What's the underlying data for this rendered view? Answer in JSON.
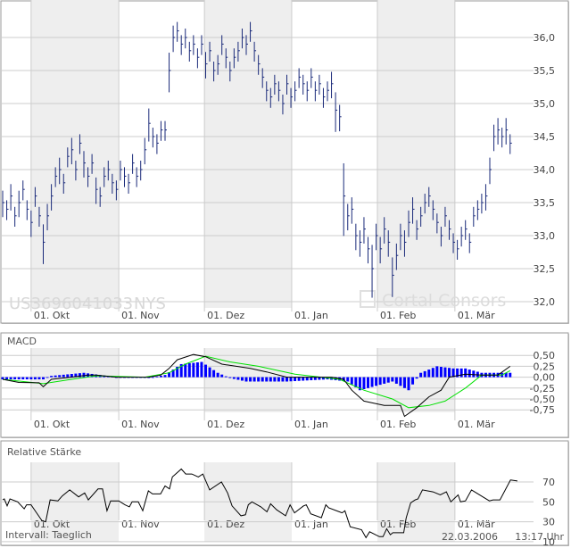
{
  "chart_data": [
    {
      "type": "ohlc",
      "title": "",
      "watermark_symbol": "US3696041033",
      "watermark_exchange": "NYS",
      "watermark_brand": "Cortal Consors",
      "yticks": [
        "36,0",
        "35,5",
        "35,0",
        "34,5",
        "34,0",
        "33,5",
        "33,0",
        "32,5",
        "32,0"
      ],
      "ytick_values": [
        36.0,
        35.5,
        35.0,
        34.5,
        34.0,
        33.5,
        33.0,
        32.5,
        32.0
      ],
      "ylim": [
        31.9,
        36.55
      ],
      "xlabels": [
        "01. Okt",
        "01. Nov",
        "01. Dez",
        "01. Jan",
        "01. Feb",
        "01. Mär"
      ],
      "month_start_bar": [
        7,
        28.6,
        49.7,
        71.2,
        92.3,
        111.4
      ],
      "bars": 126,
      "close": [
        33.5,
        33.4,
        33.6,
        33.3,
        33.5,
        33.7,
        33.4,
        33.2,
        33.6,
        33.3,
        32.9,
        33.3,
        33.6,
        33.9,
        34.0,
        33.8,
        34.2,
        34.3,
        34.0,
        34.4,
        34.1,
        33.9,
        34.1,
        33.7,
        33.6,
        33.9,
        34.0,
        33.8,
        33.7,
        34.0,
        33.9,
        33.8,
        34.1,
        33.9,
        34.0,
        34.3,
        34.7,
        34.5,
        34.4,
        34.6,
        34.6,
        35.5,
        36.0,
        36.1,
        35.9,
        36.0,
        35.8,
        35.9,
        35.7,
        35.9,
        35.6,
        35.8,
        35.5,
        35.6,
        35.9,
        35.7,
        35.5,
        35.7,
        35.8,
        36.0,
        35.9,
        36.1,
        35.8,
        35.6,
        35.4,
        35.2,
        35.1,
        35.3,
        35.2,
        35.0,
        35.3,
        35.1,
        35.2,
        35.4,
        35.3,
        35.2,
        35.4,
        35.2,
        35.3,
        35.1,
        35.2,
        35.3,
        34.9,
        34.8,
        33.6,
        33.3,
        33.4,
        33.0,
        32.9,
        33.1,
        32.8,
        32.5,
        33.0,
        32.8,
        33.1,
        32.9,
        32.4,
        32.7,
        33.0,
        32.9,
        33.2,
        33.4,
        33.1,
        33.3,
        33.5,
        33.6,
        33.4,
        33.2,
        33.0,
        33.3,
        33.1,
        32.9,
        32.8,
        33.0,
        33.1,
        32.9,
        33.3,
        33.4,
        33.5,
        33.6,
        34.0,
        34.5,
        34.6,
        34.5,
        34.6,
        34.4
      ],
      "range": [
        0.4,
        0.3,
        0.4,
        0.3,
        0.4,
        0.3,
        0.3,
        0.4,
        0.3,
        0.3,
        0.6,
        0.4,
        0.4,
        0.3,
        0.4,
        0.3,
        0.3,
        0.4,
        0.3,
        0.3,
        0.4,
        0.3,
        0.3,
        0.4,
        0.3,
        0.3,
        0.3,
        0.3,
        0.3,
        0.3,
        0.3,
        0.3,
        0.3,
        0.3,
        0.3,
        0.4,
        0.5,
        0.3,
        0.3,
        0.3,
        0.3,
        0.6,
        0.4,
        0.3,
        0.3,
        0.3,
        0.3,
        0.3,
        0.3,
        0.3,
        0.4,
        0.3,
        0.3,
        0.3,
        0.3,
        0.3,
        0.3,
        0.3,
        0.3,
        0.3,
        0.3,
        0.3,
        0.3,
        0.3,
        0.3,
        0.3,
        0.3,
        0.3,
        0.3,
        0.3,
        0.3,
        0.3,
        0.3,
        0.3,
        0.3,
        0.3,
        0.3,
        0.3,
        0.3,
        0.3,
        0.3,
        0.4,
        0.6,
        0.4,
        1.1,
        0.4,
        0.4,
        0.4,
        0.4,
        0.4,
        0.4,
        0.8,
        0.4,
        0.4,
        0.4,
        0.4,
        0.6,
        0.4,
        0.4,
        0.4,
        0.4,
        0.4,
        0.3,
        0.3,
        0.3,
        0.3,
        0.3,
        0.3,
        0.3,
        0.3,
        0.3,
        0.3,
        0.3,
        0.3,
        0.3,
        0.3,
        0.3,
        0.3,
        0.3,
        0.4,
        0.4,
        0.4,
        0.4,
        0.3,
        0.4,
        0.3
      ]
    },
    {
      "type": "line",
      "title": "MACD",
      "yticks": [
        "0,50",
        "0,25",
        "0,00",
        "-0,25",
        "-0,50",
        "-0,75"
      ],
      "ytick_values": [
        0.5,
        0.25,
        0,
        -0.25,
        -0.5,
        -0.75
      ],
      "ylim": [
        -0.95,
        0.7
      ],
      "macd": [
        [
          0,
          -0.05
        ],
        [
          4,
          -0.12
        ],
        [
          9,
          -0.13
        ],
        [
          10,
          -0.22
        ],
        [
          12,
          -0.05
        ],
        [
          17,
          0.0
        ],
        [
          21,
          0.05
        ],
        [
          23,
          0.05
        ],
        [
          28,
          0.0
        ],
        [
          36,
          0.0
        ],
        [
          39,
          0.05
        ],
        [
          41,
          0.2
        ],
        [
          43,
          0.4
        ],
        [
          47,
          0.52
        ],
        [
          50,
          0.47
        ],
        [
          54,
          0.3
        ],
        [
          61,
          0.2
        ],
        [
          65,
          0.12
        ],
        [
          70,
          0.0
        ],
        [
          81,
          0.0
        ],
        [
          84,
          -0.05
        ],
        [
          86,
          -0.3
        ],
        [
          89,
          -0.55
        ],
        [
          94,
          -0.65
        ],
        [
          98,
          -0.65
        ],
        [
          99,
          -0.9
        ],
        [
          102,
          -0.7
        ],
        [
          105,
          -0.45
        ],
        [
          108,
          -0.3
        ],
        [
          110,
          0.0
        ],
        [
          114,
          0.07
        ],
        [
          118,
          0.05
        ],
        [
          122,
          0.05
        ],
        [
          125,
          0.25
        ]
      ],
      "signal": [
        [
          0,
          -0.05
        ],
        [
          10,
          -0.15
        ],
        [
          17,
          -0.05
        ],
        [
          23,
          0.03
        ],
        [
          35,
          0.0
        ],
        [
          41,
          0.1
        ],
        [
          45,
          0.3
        ],
        [
          50,
          0.48
        ],
        [
          56,
          0.35
        ],
        [
          63,
          0.25
        ],
        [
          72,
          0.07
        ],
        [
          83,
          -0.05
        ],
        [
          89,
          -0.3
        ],
        [
          96,
          -0.5
        ],
        [
          100,
          -0.7
        ],
        [
          105,
          -0.65
        ],
        [
          109,
          -0.55
        ],
        [
          114,
          -0.25
        ],
        [
          118,
          0.05
        ],
        [
          123,
          0.05
        ],
        [
          125,
          0.15
        ]
      ],
      "histogram": [
        [
          0,
          -0.05
        ],
        [
          10,
          -0.05
        ],
        [
          12,
          0.03
        ],
        [
          20,
          0.1
        ],
        [
          28,
          0.0
        ],
        [
          36,
          -0.02
        ],
        [
          40,
          0.05
        ],
        [
          44,
          0.3
        ],
        [
          49,
          0.35
        ],
        [
          53,
          0.1
        ],
        [
          56,
          -0.02
        ],
        [
          60,
          -0.1
        ],
        [
          70,
          -0.1
        ],
        [
          80,
          -0.05
        ],
        [
          85,
          -0.1
        ],
        [
          88,
          -0.3
        ],
        [
          92,
          -0.2
        ],
        [
          96,
          -0.1
        ],
        [
          100,
          -0.3
        ],
        [
          103,
          0.1
        ],
        [
          107,
          0.25
        ],
        [
          111,
          0.2
        ],
        [
          114,
          0.2
        ],
        [
          118,
          0.1
        ],
        [
          125,
          0.1
        ]
      ],
      "colors": {
        "macd": "#000000",
        "signal": "#00e000",
        "histogram": "#0000ff"
      }
    },
    {
      "type": "line",
      "title": "Relative Stärke",
      "yticks": [
        "70",
        "50",
        "30",
        "10"
      ],
      "ytick_values": [
        70,
        50,
        30,
        10
      ],
      "ylim": [
        10,
        90
      ],
      "rsi": [
        [
          0,
          52
        ],
        [
          0.4,
          53
        ],
        [
          1.1,
          46
        ],
        [
          1.8,
          53
        ],
        [
          3.7,
          50
        ],
        [
          5.3,
          43
        ],
        [
          5.9,
          47
        ],
        [
          7,
          47
        ],
        [
          9.7,
          31
        ],
        [
          10.6,
          30
        ],
        [
          11.7,
          52
        ],
        [
          13.6,
          51
        ],
        [
          14.7,
          56
        ],
        [
          16.5,
          62
        ],
        [
          18.7,
          55
        ],
        [
          20.2,
          59
        ],
        [
          21.1,
          52
        ],
        [
          23.5,
          63
        ],
        [
          24.6,
          63
        ],
        [
          25.7,
          41
        ],
        [
          26.6,
          51
        ],
        [
          28.6,
          51
        ],
        [
          30.1,
          47
        ],
        [
          31.2,
          45
        ],
        [
          31.9,
          50
        ],
        [
          33.4,
          50
        ],
        [
          34.5,
          41
        ],
        [
          35.9,
          61
        ],
        [
          36.9,
          58
        ],
        [
          38.9,
          58
        ],
        [
          40,
          66
        ],
        [
          41.1,
          63
        ],
        [
          41.8,
          75
        ],
        [
          44,
          83
        ],
        [
          45.1,
          78
        ],
        [
          46.6,
          78
        ],
        [
          48.2,
          75
        ],
        [
          49.3,
          78
        ],
        [
          51,
          62
        ],
        [
          53.9,
          70
        ],
        [
          55.4,
          59
        ],
        [
          56.5,
          46
        ],
        [
          58.7,
          36
        ],
        [
          59.8,
          37
        ],
        [
          60.5,
          47
        ],
        [
          61.4,
          50
        ],
        [
          63.6,
          45
        ],
        [
          65.1,
          40
        ],
        [
          66,
          48
        ],
        [
          67.5,
          42
        ],
        [
          69.7,
          36
        ],
        [
          70.8,
          47
        ],
        [
          71.9,
          39
        ],
        [
          74.1,
          46
        ],
        [
          74.8,
          47
        ],
        [
          75.9,
          38
        ],
        [
          78.5,
          34
        ],
        [
          79.6,
          47
        ],
        [
          80.3,
          44
        ],
        [
          83.6,
          39
        ],
        [
          84.3,
          41
        ],
        [
          85.6,
          25
        ],
        [
          88.4,
          22
        ],
        [
          89.5,
          14
        ],
        [
          90.4,
          20
        ],
        [
          92.8,
          15
        ],
        [
          93.7,
          15
        ],
        [
          94.6,
          23
        ],
        [
          95.5,
          17
        ],
        [
          96.1,
          19
        ],
        [
          98.8,
          19
        ],
        [
          99.4,
          34
        ],
        [
          100.5,
          49
        ],
        [
          101.6,
          52
        ],
        [
          102.3,
          53
        ],
        [
          103.4,
          62
        ],
        [
          106,
          60
        ],
        [
          107.8,
          57
        ],
        [
          109.3,
          60
        ],
        [
          110.4,
          50
        ],
        [
          112.2,
          57
        ],
        [
          112.8,
          50
        ],
        [
          114,
          51
        ],
        [
          115.5,
          62
        ],
        [
          119.9,
          51
        ],
        [
          120.8,
          52
        ],
        [
          122.5,
          52
        ],
        [
          125.1,
          72
        ],
        [
          126.8,
          71
        ]
      ]
    }
  ],
  "footer": {
    "interval": "Intervall: Taeglich",
    "date": "22.03.2006",
    "time": "13:17 Uhr"
  }
}
